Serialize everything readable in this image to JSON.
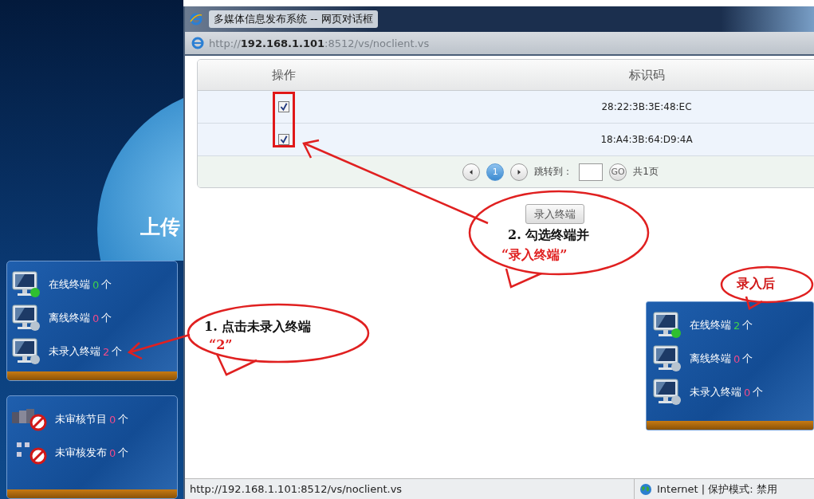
{
  "background_page": {
    "banner_text": "上传",
    "terminal_panel": {
      "items": [
        {
          "kind": "online",
          "label": "在线终端",
          "count": "0",
          "unit": "个"
        },
        {
          "kind": "offline",
          "label": "离线终端",
          "count": "0",
          "unit": "个"
        },
        {
          "kind": "unregistered",
          "label": "未录入终端",
          "count": "2",
          "unit": "个"
        }
      ]
    },
    "review_panel": {
      "items": [
        {
          "kind": "program",
          "label": "未审核节目",
          "count": "0",
          "unit": "个"
        },
        {
          "kind": "publish",
          "label": "未审核发布",
          "count": "0",
          "unit": "个"
        }
      ]
    }
  },
  "dialog": {
    "title": "多媒体信息发布系统 -- 网页对话框",
    "address": "http://**192.168.1.101**:8512/vs/noclient.vs",
    "table": {
      "columns": [
        "操作",
        "标识码"
      ],
      "rows": [
        {
          "checked": true,
          "id": "28:22:3B:3E:48:EC"
        },
        {
          "checked": true,
          "id": "18:A4:3B:64:D9:4A"
        }
      ]
    },
    "pager": {
      "pages": [
        {
          "label": "1",
          "selected": true
        }
      ],
      "jump_label": "跳转到：",
      "go": "GO",
      "total": "共1页"
    },
    "button": "录入终端",
    "status_bar": {
      "url": "http://192.168.1.101:8512/vs/noclient.vs",
      "zone": "Internet | 保护模式: 禁用"
    }
  },
  "after_panel": {
    "items": [
      {
        "kind": "online",
        "label": "在线终端",
        "count": "2",
        "unit": "个"
      },
      {
        "kind": "offline",
        "label": "离线终端",
        "count": "0",
        "unit": "个"
      },
      {
        "kind": "unregistered",
        "label": "未录入终端",
        "count": "0",
        "unit": "个"
      }
    ]
  },
  "annotations": [
    {
      "text": "1. 点击未录入终端",
      "highlight": "“2”"
    },
    {
      "text": "2. 勾选终端并",
      "highlight": "“录入终端”"
    },
    {
      "text": "录入后"
    }
  ]
}
